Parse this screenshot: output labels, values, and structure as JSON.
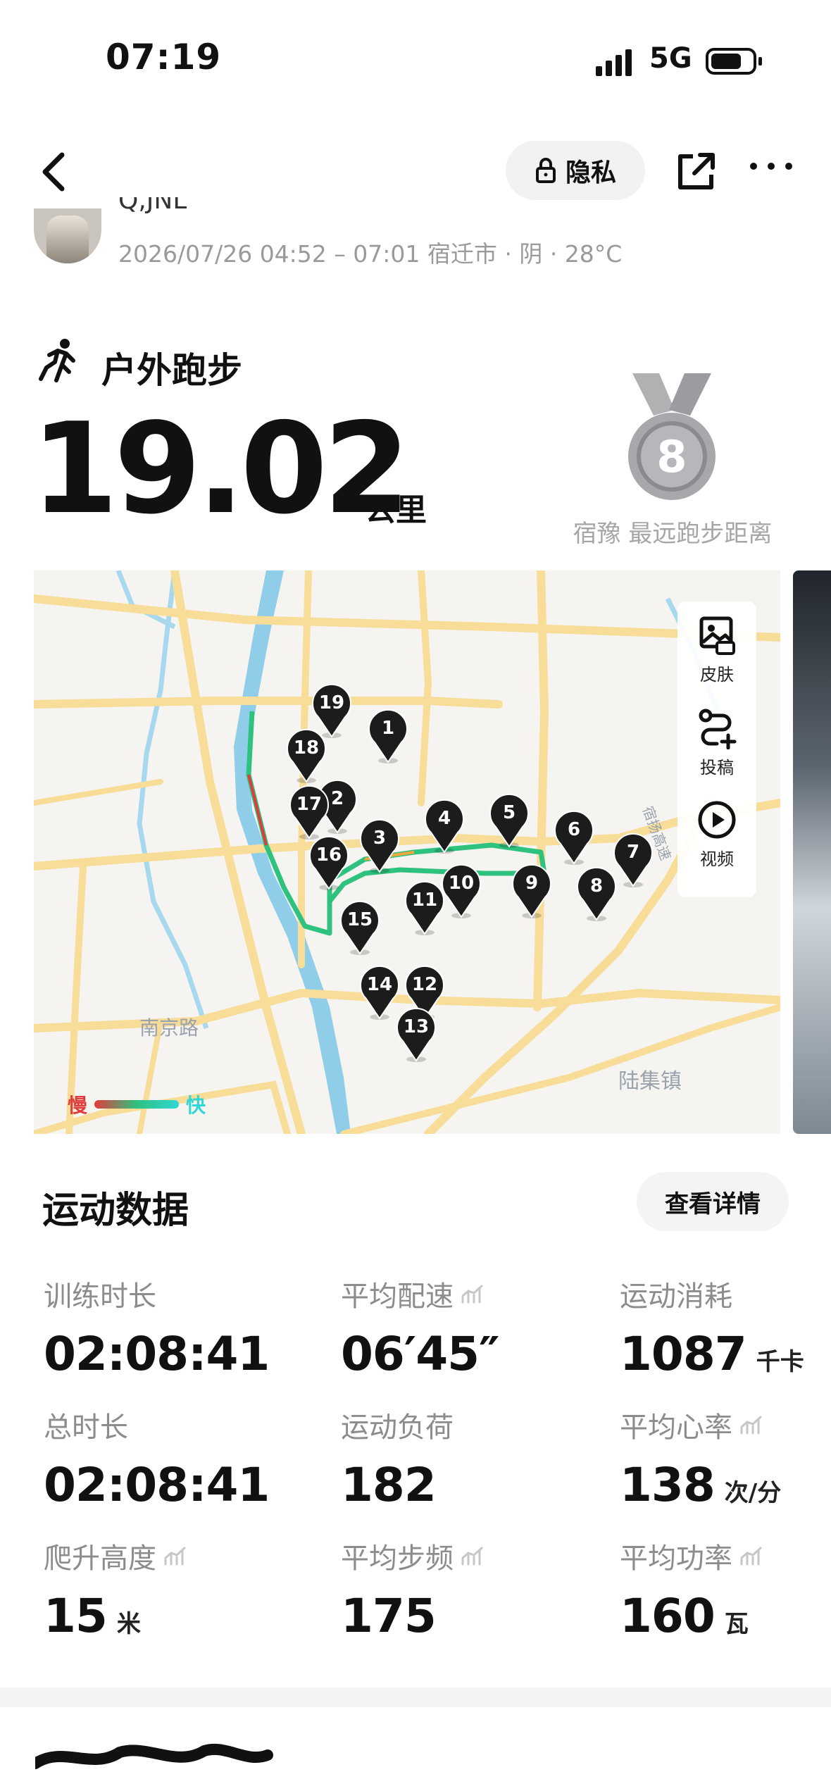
{
  "status_bar": {
    "time": "07:19",
    "network": "5G"
  },
  "nav": {
    "privacy_label": "隐私"
  },
  "user": {
    "name": "Q,JNL",
    "meta": "2026/07/26 04:52 – 07:01 宿迁市 · 阴 · 28°C"
  },
  "activity": {
    "type": "户外跑步",
    "distance": "19.02",
    "distance_unit": "公里",
    "medal_number": "8",
    "medal_caption": "宿豫 最远跑步距离"
  },
  "map": {
    "tools": [
      {
        "label": "皮肤",
        "icon": "image-icon"
      },
      {
        "label": "投稿",
        "icon": "route-add-icon"
      },
      {
        "label": "视频",
        "icon": "play-icon"
      }
    ],
    "pins": [
      "1",
      "2",
      "3",
      "4",
      "5",
      "6",
      "7",
      "8",
      "9",
      "10",
      "11",
      "12",
      "13",
      "14",
      "15",
      "16",
      "17",
      "18",
      "19"
    ],
    "places": {
      "road": "南京路",
      "town": "陆集镇",
      "highway": "宿扬高速"
    },
    "legend": {
      "slow": "慢",
      "fast": "快",
      "slow_color": "#e23b3b",
      "fast_color": "#31d6d6"
    },
    "route_color": "#2ec27e"
  },
  "stats": {
    "title": "运动数据",
    "detail_button": "查看详情",
    "items": [
      {
        "label": "训练时长",
        "value": "02:08:41",
        "unit": ""
      },
      {
        "label": "平均配速",
        "value": "06′45″",
        "unit": ""
      },
      {
        "label": "运动消耗",
        "value": "1087",
        "unit": "千卡"
      },
      {
        "label": "总时长",
        "value": "02:08:41",
        "unit": ""
      },
      {
        "label": "运动负荷",
        "value": "182",
        "unit": ""
      },
      {
        "label": "平均心率",
        "value": "138",
        "unit": "次/分"
      },
      {
        "label": "爬升高度",
        "value": "15",
        "unit": "米"
      },
      {
        "label": "平均步频",
        "value": "175",
        "unit": ""
      },
      {
        "label": "平均功率",
        "value": "160",
        "unit": "瓦"
      }
    ]
  }
}
